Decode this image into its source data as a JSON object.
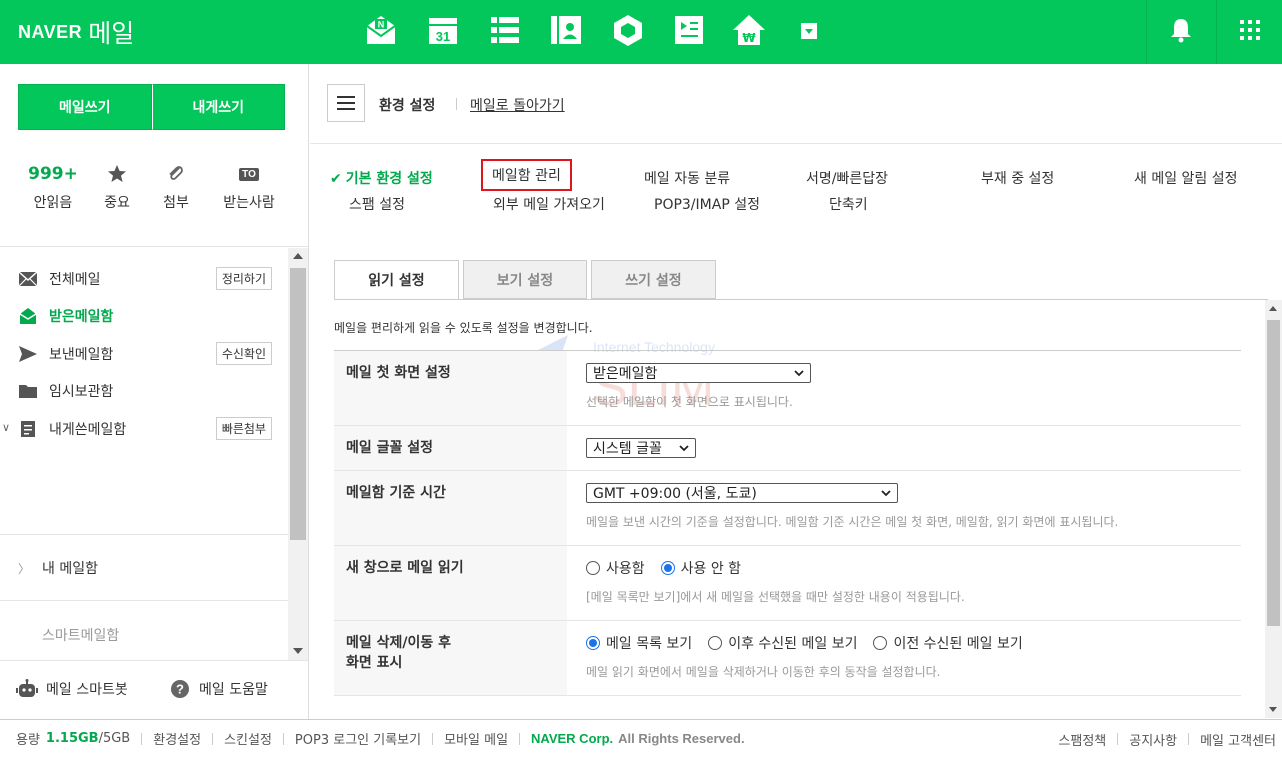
{
  "brand": {
    "naver": "NAVER",
    "mail": "메일"
  },
  "colors": {
    "brand_green": "#03c75a",
    "accent_green": "#03a94d",
    "highlight_red": "#e0141e",
    "radio_blue": "#1a73e8"
  },
  "topnav": {
    "icons": [
      "mail-icon",
      "calendar-icon",
      "contacts-list-icon",
      "address-book-icon",
      "cube-icon",
      "memo-icon",
      "pay-house-icon",
      "more-dropdown-icon"
    ],
    "calendar_day": "31",
    "mail_badge": "N"
  },
  "sidebar": {
    "write_label": "메일쓰기",
    "write_self_label": "내게쓰기",
    "quick": {
      "unread_count": "999+",
      "unread_label": "안읽음",
      "important_label": "중요",
      "attachment_label": "첨부",
      "to_badge": "TO",
      "to_label": "받는사람"
    },
    "folders": [
      {
        "name": "전체메일",
        "button": "정리하기",
        "icon": "envelope-icon"
      },
      {
        "name": "받은메일함",
        "button": "",
        "icon": "inbox-icon"
      },
      {
        "name": "보낸메일함",
        "button": "수신확인",
        "icon": "send-icon"
      },
      {
        "name": "임시보관함",
        "button": "",
        "icon": "folder-icon"
      },
      {
        "name": "내게쓴메일함",
        "button": "빠른첨부",
        "icon": "note-icon"
      }
    ],
    "my_mailbox": "내 메일함",
    "smart_mailbox": "스마트메일함",
    "smartbot": "메일 스마트봇",
    "help": "메일 도움말"
  },
  "header": {
    "title": "환경 설정",
    "back_link": "메일로 돌아가기"
  },
  "settings_menu": {
    "basic": "기본 환경 설정",
    "spam": "스팸 설정",
    "mailbox_manage": "메일함 관리",
    "external": "외부 메일 가져오기",
    "auto_sort": "메일 자동 분류",
    "pop3": "POP3/IMAP 설정",
    "signature": "서명/빠른답장",
    "shortcut": "단축키",
    "absence": "부재 중 설정",
    "new_alert": "새 메일 알림 설정"
  },
  "tabs": [
    "읽기 설정",
    "보기 설정",
    "쓰기 설정"
  ],
  "description": "메일을 편리하게 읽을 수 있도록 설정을 변경합니다.",
  "watermark": {
    "line1": "Internet Technology",
    "line2": "SLIM"
  },
  "rows": [
    {
      "label": "메일 첫 화면 설정",
      "select": "받은메일함",
      "hint": "선택한 메일함이 첫 화면으로 표시됩니다."
    },
    {
      "label": "메일 글꼴 설정",
      "select": "시스템 글꼴",
      "hint": ""
    },
    {
      "label": "메일함 기준 시간",
      "select": "GMT +09:00 (서울, 도쿄)",
      "hint": "메일을 보낸 시간의 기준을 설정합니다. 메일함 기준 시간은 메일 첫 화면, 메일함, 읽기 화면에 표시됩니다."
    },
    {
      "label": "새 창으로 메일 읽기",
      "options": [
        "사용함",
        "사용 안 함"
      ],
      "selected": 1,
      "hint": "[메일 목록만 보기]에서 새 메일을 선택했을 때만 설정한 내용이 적용됩니다."
    },
    {
      "label": "메일 삭제/이동 후\n화면 표시",
      "options": [
        "메일 목록 보기",
        "이후 수신된 메일 보기",
        "이전 수신된 메일 보기"
      ],
      "selected": 0,
      "hint": "메일 읽기 화면에서 메일을 삭제하거나 이동한 후의 동작을 설정합니다."
    }
  ],
  "footer": {
    "storage_label": "용량",
    "storage_used": "1.15GB",
    "storage_total": "/5GB",
    "links": [
      "환경설정",
      "스킨설정",
      "POP3 로그인 기록보기",
      "모바일 메일"
    ],
    "corp": "NAVER Corp.",
    "rights": "All Rights Reserved.",
    "right_links": [
      "스팸정책",
      "공지사항",
      "메일 고객센터"
    ]
  }
}
